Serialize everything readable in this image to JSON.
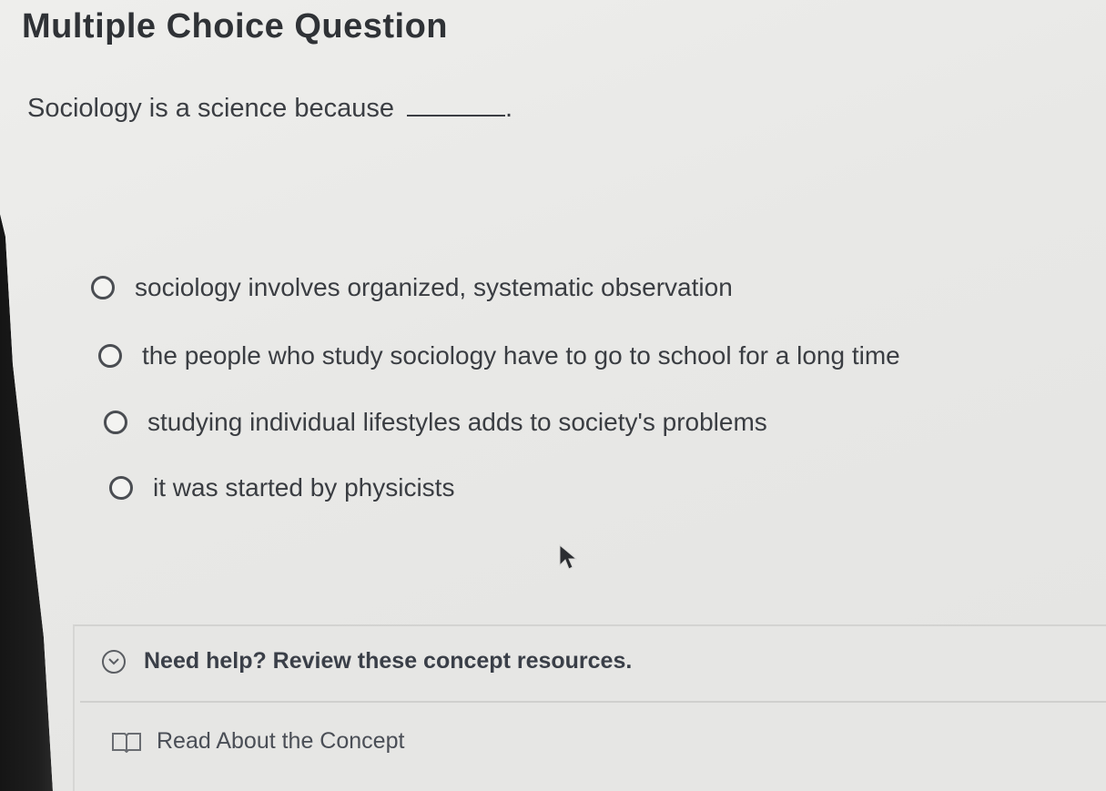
{
  "question": {
    "heading": "Multiple Choice Question",
    "prompt": "Sociology is a science because",
    "prompt_end": "."
  },
  "options": [
    {
      "label": "sociology involves organized, systematic observation"
    },
    {
      "label": "the people who study sociology have to go to school for a long time"
    },
    {
      "label": "studying individual lifestyles adds to society's problems"
    },
    {
      "label": "it was started by physicists"
    }
  ],
  "help": {
    "toggle_label": "Need help? Review these concept resources.",
    "toggle_icon": "chevron-down-icon",
    "resource_label": "Read About the Concept",
    "resource_icon": "book-icon"
  }
}
